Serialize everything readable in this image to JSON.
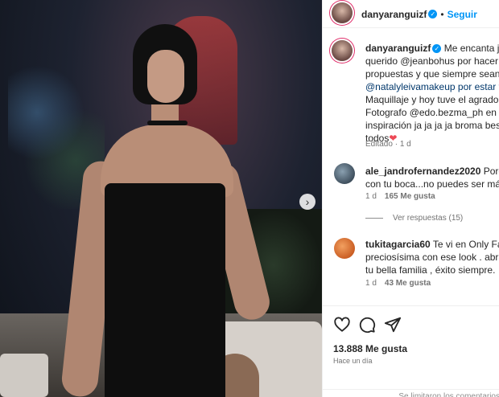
{
  "post": {
    "username": "danyaranguizf",
    "follow_label": "Seguir",
    "caption_lines": [
      "Me encanta jugar",
      "querido @jeanbohus por hacer ma",
      "propuestas y que siempre sean dif",
      "@natalyleivamakeup por estar tod",
      "Maquillaje y hoy tuve el agrado de",
      "Fotografo @edo.bezma_ph en la ú",
      "inspiración ja ja ja ja broma bes",
      "todos"
    ],
    "caption_heart": "❤",
    "edited_label": "Editado",
    "edited_age": "1 d",
    "likes": "13.888 Me gusta",
    "posted_ago": "Hace un día",
    "comments_limited": "Se limitaron los comentarios"
  },
  "comments": [
    {
      "username": "ale_jandrofernandez2020",
      "text_line1": "Porque",
      "text_line2": "con tu boca...no puedes ser más n",
      "age": "1 d",
      "likes": "165 Me gusta",
      "replies": "Ver respuestas (15)",
      "avatar_color": "#4a5a6a"
    },
    {
      "username": "tukitagarcia60",
      "text_line1": "Te vi en Only Fama",
      "text_line2": "preciosísima con ese look . abracit",
      "text_line3": "tu bella familia , éxito siempre.",
      "age": "1 d",
      "likes": "43 Me gusta",
      "avatar_color": "#e8743b"
    }
  ],
  "icons": {
    "like": "heart-outline-icon",
    "comment": "comment-bubble-icon",
    "share": "paper-plane-icon",
    "next": "chevron-right-icon"
  },
  "colors": {
    "accent": "#0095f6",
    "heart": "#ed4956",
    "muted": "#737373"
  }
}
